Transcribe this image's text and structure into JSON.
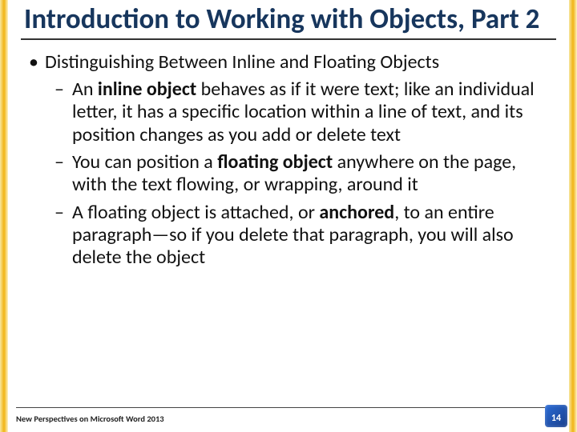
{
  "title": "Introduction to Working with Objects, Part 2",
  "bullets": {
    "lvl1": "Distinguishing Between Inline and Floating Objects",
    "b1a": "An ",
    "b1b": "inline object",
    "b1c": " behaves as if it were text; like an individual letter, it has a specific location within a line of text, and its position changes as you add or delete text",
    "b2a": "You can position a ",
    "b2b": "floating object",
    "b2c": " anywhere on the page, with the text flowing, or wrapping, around it",
    "b3a": "A floating object is attached, or ",
    "b3b": "anchored",
    "b3c": ", to an entire paragraph—so if you delete that paragraph, you will also delete the object"
  },
  "footer": {
    "text": "New Perspectives on Microsoft Word 2013",
    "page": "14"
  }
}
